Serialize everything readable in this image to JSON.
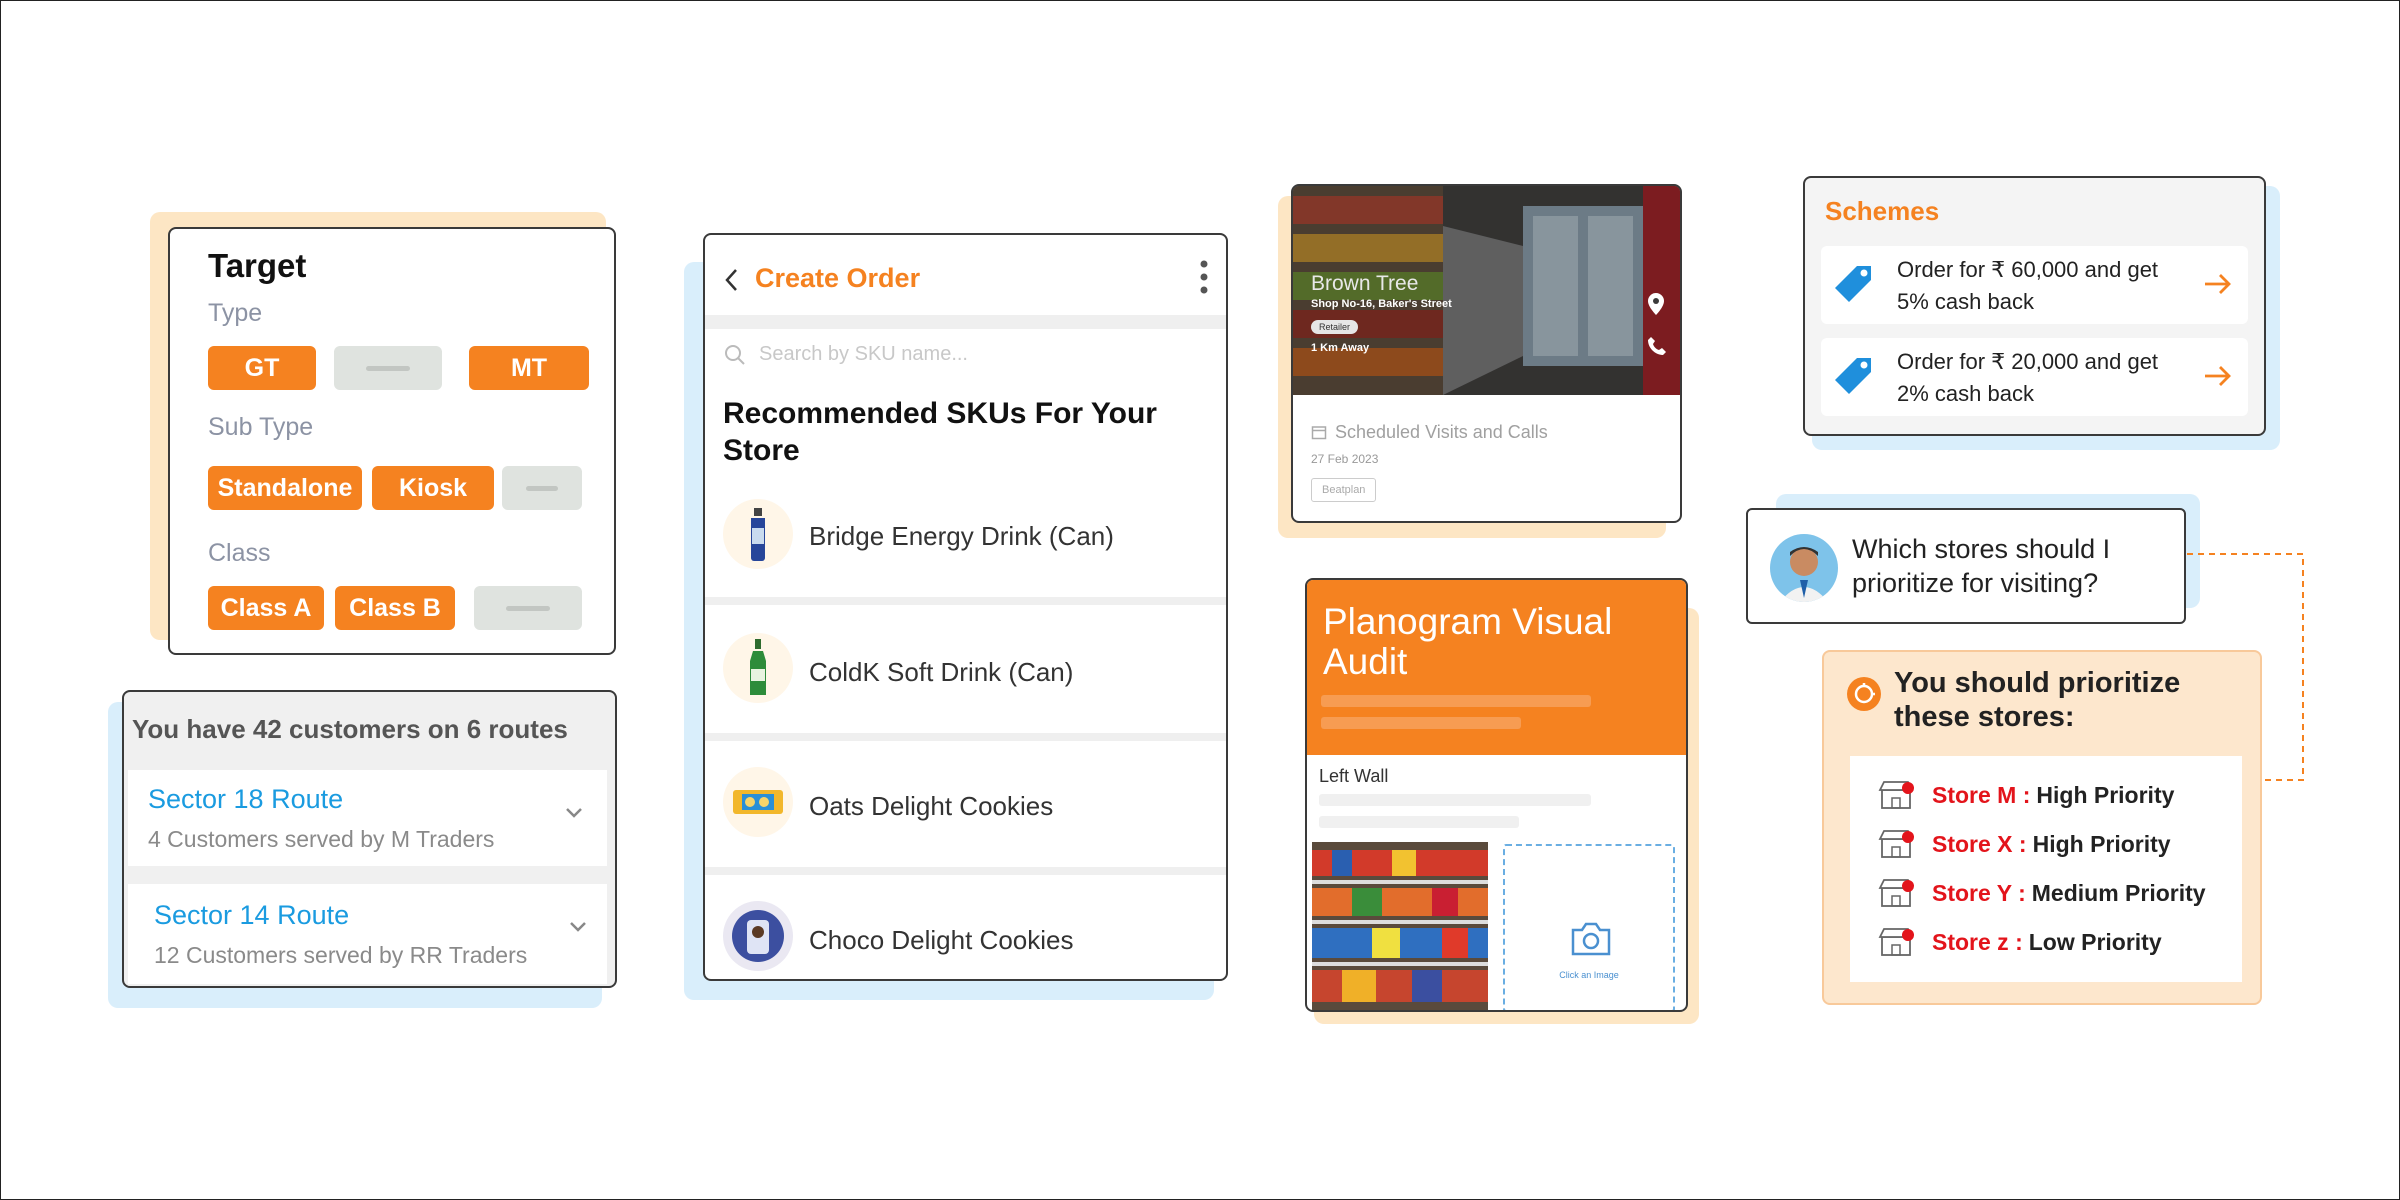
{
  "target_card": {
    "title": "Target",
    "type_label": "Type",
    "type_pills": [
      "GT",
      "MT"
    ],
    "subtype_label": "Sub Type",
    "subtype_pills": [
      "Standalone",
      "Kiosk"
    ],
    "class_label": "Class",
    "class_pills": [
      "Class A",
      "Class B"
    ]
  },
  "routes_card": {
    "header": "You have 42 customers on 6 routes",
    "routes": [
      {
        "name": "Sector 18 Route",
        "detail": "4 Customers served by M Traders"
      },
      {
        "name": "Sector 14 Route",
        "detail": "12 Customers served by RR Traders"
      }
    ]
  },
  "order_card": {
    "title": "Create Order",
    "search_placeholder": "Search by SKU name...",
    "section_title": "Recommended SKUs For Your Store",
    "skus": [
      {
        "name": "Bridge Energy Drink (Can)",
        "icon": "energy-drink-bottle-icon"
      },
      {
        "name": "ColdK Soft Drink (Can)",
        "icon": "soft-drink-bottle-icon"
      },
      {
        "name": "Oats Delight Cookies",
        "icon": "cookie-pack-icon"
      },
      {
        "name": "Choco Delight Cookies",
        "icon": "choco-pack-icon"
      }
    ]
  },
  "store_card": {
    "store_name": "Brown Tree",
    "address": "Shop No-16, Baker's Street",
    "tag": "Retailer",
    "distance": "1 Km Away",
    "section": "Scheduled Visits and Calls",
    "date": "27 Feb 2023",
    "button": "Beatplan"
  },
  "planogram_card": {
    "title": "Planogram Visual Audit",
    "wall_label": "Left Wall",
    "upload_label": "Click an Image"
  },
  "schemes_card": {
    "title": "Schemes",
    "schemes": [
      {
        "text": "Order for ₹ 60,000 and get 5% cash back"
      },
      {
        "text": "Order for ₹ 20,000 and get 2% cash back"
      }
    ]
  },
  "chat": {
    "question": "Which stores should I prioritize for visiting?",
    "answer_title": "You should prioritize these stores:",
    "stores": [
      {
        "name": "Store M :",
        "priority": "High Priority"
      },
      {
        "name": "Store X :",
        "priority": "High Priority"
      },
      {
        "name": "Store Y :",
        "priority": "Medium Priority"
      },
      {
        "name": "Store z :",
        "priority": "Low Priority"
      }
    ]
  },
  "colors": {
    "brand_orange": "#f58220",
    "link_blue": "#1a9be0",
    "priority_red": "#e3141b",
    "tag_blue": "#1f8fdc"
  }
}
